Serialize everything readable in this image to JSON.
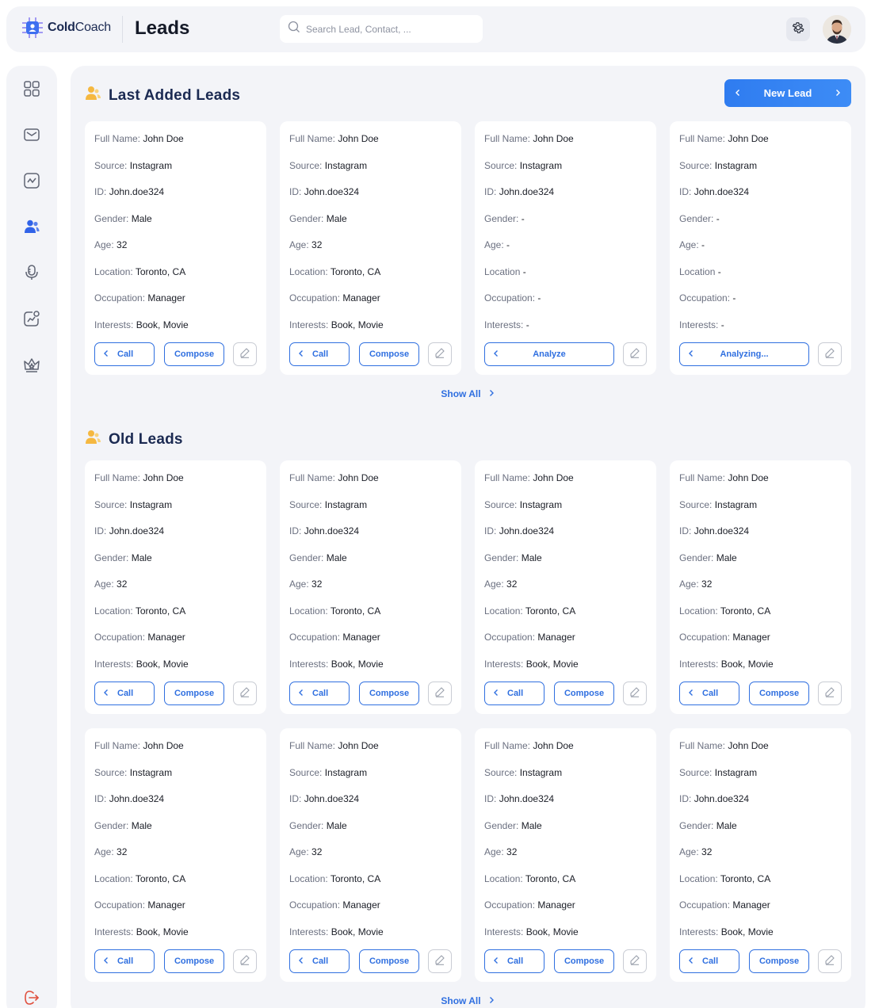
{
  "app": {
    "logo_bold": "Cold",
    "logo_thin": "Coach",
    "page_title": "Leads"
  },
  "search": {
    "placeholder": "Search Lead, Contact, ..."
  },
  "sidebar": {
    "items": [
      "dashboard-icon",
      "mail-icon",
      "analytics-icon",
      "leads-icon",
      "microphone-icon",
      "growth-icon",
      "crown-icon",
      "logout-icon"
    ],
    "active": "leads-icon"
  },
  "colors": {
    "accent": "#2f6fe0",
    "title": "#1b2a52",
    "section_icon": "#f5b840"
  },
  "last_added": {
    "title": "Last Added Leads",
    "new_lead_label": "New Lead",
    "show_all": "Show All",
    "cards": [
      {
        "rows": [
          [
            "Full Name:",
            "John Doe"
          ],
          [
            "Source:",
            "Instagram"
          ],
          [
            "ID:",
            "John.doe324"
          ],
          [
            "Gender:",
            "Male"
          ],
          [
            "Age:",
            "32"
          ],
          [
            "Location:",
            "Toronto, CA"
          ],
          [
            "Occupation:",
            "Manager"
          ],
          [
            "Interests:",
            "Book, Movie"
          ]
        ],
        "mode": "normal",
        "call": "Call",
        "compose": "Compose"
      },
      {
        "rows": [
          [
            "Full Name:",
            "John Doe"
          ],
          [
            "Source:",
            "Instagram"
          ],
          [
            "ID:",
            "John.doe324"
          ],
          [
            "Gender:",
            "Male"
          ],
          [
            "Age:",
            "32"
          ],
          [
            "Location:",
            "Toronto, CA"
          ],
          [
            "Occupation:",
            "Manager"
          ],
          [
            "Interests:",
            "Book, Movie"
          ]
        ],
        "mode": "normal",
        "call": "Call",
        "compose": "Compose"
      },
      {
        "rows": [
          [
            "Full Name:",
            "John Doe"
          ],
          [
            "Source:",
            "Instagram"
          ],
          [
            "ID:",
            "John.doe324"
          ],
          [
            "Gender:",
            "-"
          ],
          [
            "Age:",
            "-"
          ],
          [
            "Location",
            "-"
          ],
          [
            "Occupation:",
            "-"
          ],
          [
            "Interests:",
            "-"
          ]
        ],
        "mode": "analyze",
        "action": "Analyze"
      },
      {
        "rows": [
          [
            "Full Name:",
            "John Doe"
          ],
          [
            "Source:",
            "Instagram"
          ],
          [
            "ID:",
            "John.doe324"
          ],
          [
            "Gender:",
            "-"
          ],
          [
            "Age:",
            "-"
          ],
          [
            "Location",
            "-"
          ],
          [
            "Occupation:",
            "-"
          ],
          [
            "Interests:",
            "-"
          ]
        ],
        "mode": "analyze",
        "action": "Analyzing..."
      }
    ]
  },
  "old_leads": {
    "title": "Old Leads",
    "show_all": "Show All",
    "cards": [
      {
        "rows": [
          [
            "Full Name:",
            "John Doe"
          ],
          [
            "Source:",
            "Instagram"
          ],
          [
            "ID:",
            "John.doe324"
          ],
          [
            "Gender:",
            "Male"
          ],
          [
            "Age:",
            "32"
          ],
          [
            "Location:",
            "Toronto, CA"
          ],
          [
            "Occupation:",
            "Manager"
          ],
          [
            "Interests:",
            "Book, Movie"
          ]
        ],
        "mode": "normal",
        "call": "Call",
        "compose": "Compose"
      },
      {
        "rows": [
          [
            "Full Name:",
            "John Doe"
          ],
          [
            "Source:",
            "Instagram"
          ],
          [
            "ID:",
            "John.doe324"
          ],
          [
            "Gender:",
            "Male"
          ],
          [
            "Age:",
            "32"
          ],
          [
            "Location:",
            "Toronto, CA"
          ],
          [
            "Occupation:",
            "Manager"
          ],
          [
            "Interests:",
            "Book, Movie"
          ]
        ],
        "mode": "normal",
        "call": "Call",
        "compose": "Compose"
      },
      {
        "rows": [
          [
            "Full Name:",
            "John Doe"
          ],
          [
            "Source:",
            "Instagram"
          ],
          [
            "ID:",
            "John.doe324"
          ],
          [
            "Gender:",
            "Male"
          ],
          [
            "Age:",
            "32"
          ],
          [
            "Location:",
            "Toronto, CA"
          ],
          [
            "Occupation:",
            "Manager"
          ],
          [
            "Interests:",
            "Book, Movie"
          ]
        ],
        "mode": "normal",
        "call": "Call",
        "compose": "Compose"
      },
      {
        "rows": [
          [
            "Full Name:",
            "John Doe"
          ],
          [
            "Source:",
            "Instagram"
          ],
          [
            "ID:",
            "John.doe324"
          ],
          [
            "Gender:",
            "Male"
          ],
          [
            "Age:",
            "32"
          ],
          [
            "Location:",
            "Toronto, CA"
          ],
          [
            "Occupation:",
            "Manager"
          ],
          [
            "Interests:",
            "Book, Movie"
          ]
        ],
        "mode": "normal",
        "call": "Call",
        "compose": "Compose"
      },
      {
        "rows": [
          [
            "Full Name:",
            "John Doe"
          ],
          [
            "Source:",
            "Instagram"
          ],
          [
            "ID:",
            "John.doe324"
          ],
          [
            "Gender:",
            "Male"
          ],
          [
            "Age:",
            "32"
          ],
          [
            "Location:",
            "Toronto, CA"
          ],
          [
            "Occupation:",
            "Manager"
          ],
          [
            "Interests:",
            "Book, Movie"
          ]
        ],
        "mode": "normal",
        "call": "Call",
        "compose": "Compose"
      },
      {
        "rows": [
          [
            "Full Name:",
            "John Doe"
          ],
          [
            "Source:",
            "Instagram"
          ],
          [
            "ID:",
            "John.doe324"
          ],
          [
            "Gender:",
            "Male"
          ],
          [
            "Age:",
            "32"
          ],
          [
            "Location:",
            "Toronto, CA"
          ],
          [
            "Occupation:",
            "Manager"
          ],
          [
            "Interests:",
            "Book, Movie"
          ]
        ],
        "mode": "normal",
        "call": "Call",
        "compose": "Compose"
      },
      {
        "rows": [
          [
            "Full Name:",
            "John Doe"
          ],
          [
            "Source:",
            "Instagram"
          ],
          [
            "ID:",
            "John.doe324"
          ],
          [
            "Gender:",
            "Male"
          ],
          [
            "Age:",
            "32"
          ],
          [
            "Location:",
            "Toronto, CA"
          ],
          [
            "Occupation:",
            "Manager"
          ],
          [
            "Interests:",
            "Book, Movie"
          ]
        ],
        "mode": "normal",
        "call": "Call",
        "compose": "Compose"
      },
      {
        "rows": [
          [
            "Full Name:",
            "John Doe"
          ],
          [
            "Source:",
            "Instagram"
          ],
          [
            "ID:",
            "John.doe324"
          ],
          [
            "Gender:",
            "Male"
          ],
          [
            "Age:",
            "32"
          ],
          [
            "Location:",
            "Toronto, CA"
          ],
          [
            "Occupation:",
            "Manager"
          ],
          [
            "Interests:",
            "Book, Movie"
          ]
        ],
        "mode": "normal",
        "call": "Call",
        "compose": "Compose"
      }
    ]
  }
}
